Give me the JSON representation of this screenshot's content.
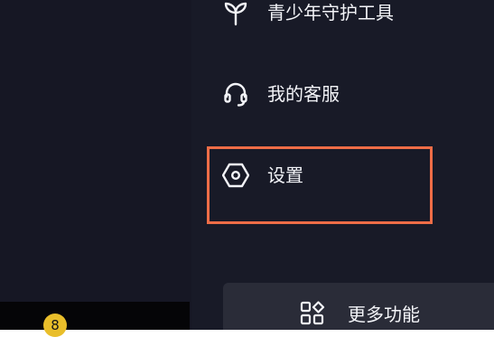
{
  "menu": {
    "items": [
      {
        "label": "青少年守护工具",
        "icon": "sprout-icon"
      },
      {
        "label": "我的客服",
        "icon": "headset-icon"
      },
      {
        "label": "设置",
        "icon": "hexagon-settings-icon"
      }
    ]
  },
  "more_functions": {
    "label": "更多功能",
    "icon": "grid-shapes-icon"
  },
  "bottom_badge": {
    "count": "8"
  },
  "colors": {
    "background_left": "#161724",
    "background_drawer": "#181a27",
    "highlight_border": "#ee6d47",
    "badge": "#e9be2a"
  }
}
